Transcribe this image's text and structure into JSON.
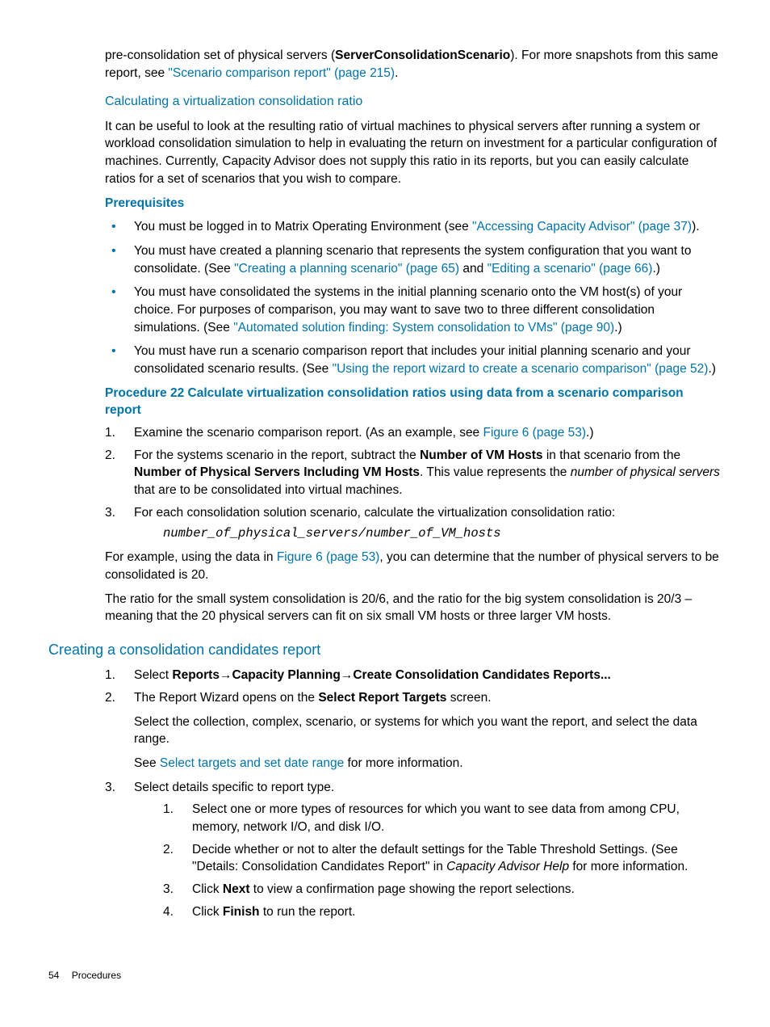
{
  "intro": {
    "p1a": "pre-consolidation set of physical servers (",
    "p1bold": "ServerConsolidationScenario",
    "p1b": "). For more snapshots from this same report, see ",
    "p1link": "\"Scenario comparison report\" (page 215)",
    "p1c": "."
  },
  "calc": {
    "heading": "Calculating a virtualization consolidation ratio",
    "p1": "It can be useful to look at the resulting ratio of virtual machines to physical servers after running a system or workload consolidation simulation to help in evaluating the return on investment for a particular configuration of machines. Currently, Capacity Advisor does not supply this ratio in its reports, but you can easily calculate ratios for a set of scenarios that you wish to compare."
  },
  "prereq": {
    "heading": "Prerequisites",
    "b1a": "You must be logged in to Matrix Operating Environment (see ",
    "b1link": "\"Accessing Capacity Advisor\" (page 37)",
    "b1b": ").",
    "b2a": "You must have created a planning scenario that represents the system configuration that you want to consolidate. (See ",
    "b2link1": "\"Creating a planning scenario\" (page 65)",
    "b2mid": " and ",
    "b2link2": "\"Editing a scenario\" (page 66)",
    "b2b": ".)",
    "b3a": "You must have consolidated the systems in the initial planning scenario onto the VM host(s) of your choice. For purposes of comparison, you may want to save two to three different consolidation simulations. (See ",
    "b3link": "\"Automated solution finding: System consolidation to VMs\" (page 90)",
    "b3b": ".)",
    "b4a": "You must have run a scenario comparison report that includes your initial planning scenario and your consolidated scenario results. (See ",
    "b4link": "\"Using the report wizard to create a scenario comparison\" (page 52)",
    "b4b": ".)"
  },
  "proc22": {
    "heading": "Procedure 22 Calculate virtualization consolidation ratios using data from a scenario comparison report",
    "s1a": "Examine the scenario comparison report. (As an example, see ",
    "s1link": "Figure 6 (page 53)",
    "s1b": ".)",
    "s2a": "For the systems scenario in the report, subtract the ",
    "s2b1": "Number of VM Hosts",
    "s2b": " in that scenario from the ",
    "s2b2": "Number of Physical Servers Including VM Hosts",
    "s2c": ". This value represents the ",
    "s2em": "number of physical servers",
    "s2d": " that are to be consolidated into virtual machines.",
    "s3": "For each consolidation solution scenario, calculate the virtualization consolidation ratio:",
    "formula": "number_of_physical_servers/number_of_VM_hosts",
    "p_after1a": "For example, using the data in ",
    "p_after1link": "Figure 6 (page 53)",
    "p_after1b": ", you can determine that the number of physical servers to be consolidated is 20.",
    "p_after2": "The ratio for the small system consolidation is 20/6, and the ratio for the big system consolidation is 20/3 – meaning that the 20 physical servers can fit on six small VM hosts or three larger VM hosts."
  },
  "creating": {
    "heading": "Creating a consolidation candidates report",
    "s1a": "Select ",
    "s1b1": "Reports",
    "s1arrow": "→",
    "s1b2": "Capacity Planning",
    "s1b3": "Create Consolidation Candidates Reports...",
    "s2a": "The Report Wizard opens on the ",
    "s2bold": "Select Report Targets",
    "s2b": " screen.",
    "s2p1": "Select the collection, complex, scenario, or systems for which you want the report, and select the data range.",
    "s2p2a": "See ",
    "s2p2link": "Select targets and set date range",
    "s2p2b": " for more information.",
    "s3": "Select details specific to report type.",
    "sub1": "Select one or more types of resources for which you want to see data from among CPU, memory, network I/O, and disk I/O.",
    "sub2a": "Decide whether or not to alter the default settings for the Table Threshold Settings. (See \"Details: Consolidation Candidates Report\" in ",
    "sub2em": "Capacity Advisor Help",
    "sub2b": " for more information.",
    "sub3a": "Click ",
    "sub3bold": "Next",
    "sub3b": " to view a confirmation page showing the report selections.",
    "sub4a": "Click ",
    "sub4bold": "Finish",
    "sub4b": " to run the report."
  },
  "footer": {
    "page": "54",
    "section": "Procedures"
  }
}
